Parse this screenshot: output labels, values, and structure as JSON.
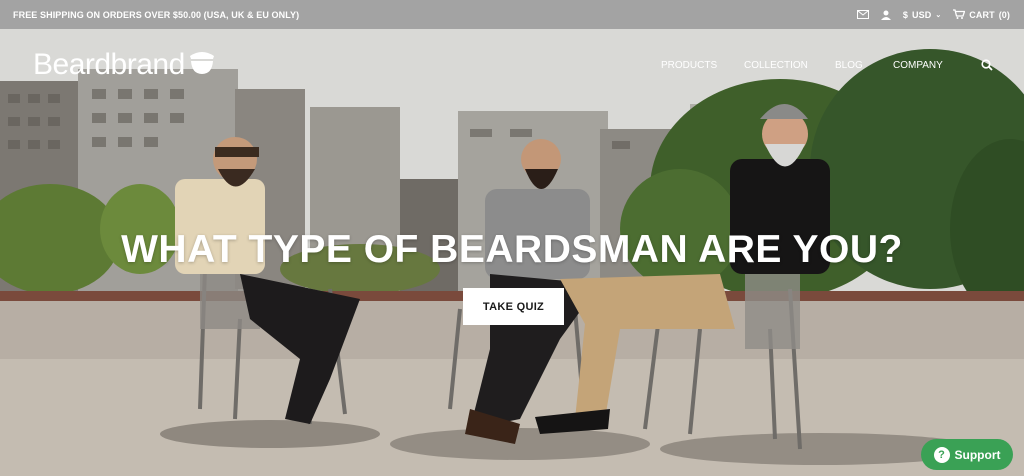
{
  "announcement": "FREE SHIPPING ON ORDERS OVER $50.00 (USA, UK & EU ONLY)",
  "currency": {
    "symbol": "$",
    "code": "USD"
  },
  "cart": {
    "label": "CART",
    "count": "(0)"
  },
  "brand": {
    "name": "Beardbrand"
  },
  "nav": {
    "products": "PRODUCTS",
    "collection": "COLLECTION",
    "blog": "BLOG",
    "company": "COMPANY"
  },
  "hero": {
    "headline": "WHAT TYPE OF BEARDSMAN ARE YOU?",
    "cta": "TAKE QUIZ"
  },
  "support": {
    "label": "Support"
  },
  "colors": {
    "topbar": "#a3a3a3",
    "support_green": "#3aa155"
  },
  "icons": [
    "mail-icon",
    "user-icon",
    "cart-icon",
    "search-icon",
    "help-icon"
  ]
}
